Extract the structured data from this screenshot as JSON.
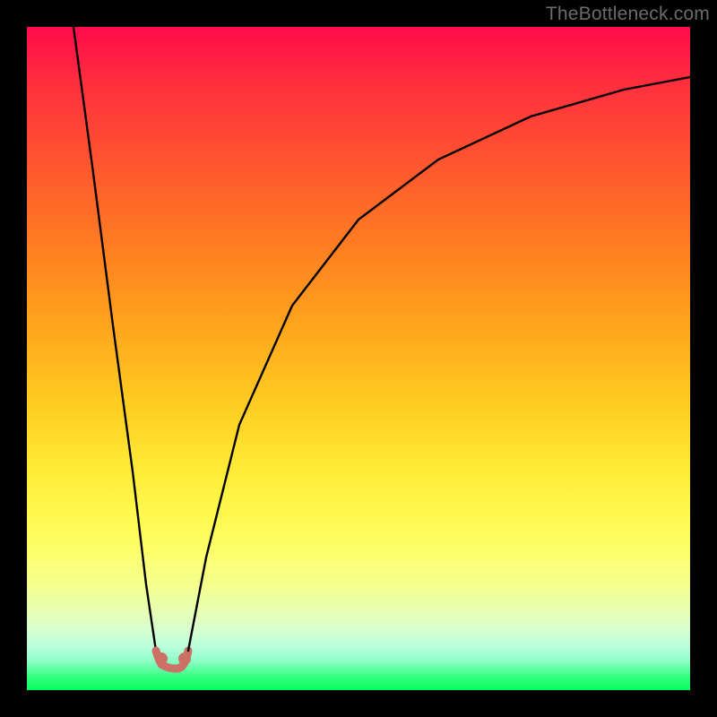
{
  "watermark": {
    "text": "TheBottleneck.com"
  },
  "colors": {
    "frame": "#000000",
    "curve_stroke": "#000000",
    "node_fill": "#cd7066",
    "gradient_stops": [
      "#ff0b4b",
      "#ff2d3f",
      "#ff4a33",
      "#ff6a27",
      "#ff8a1f",
      "#ffab1d",
      "#ffcd22",
      "#ffe935",
      "#fff84c",
      "#fdff6a",
      "#f4ff8c",
      "#e8ffb2",
      "#d6ffd0",
      "#b9ffdc",
      "#8fffc8",
      "#5aff9e",
      "#2bff7a",
      "#05ff5e"
    ]
  },
  "chart_data": {
    "type": "line",
    "x_meaning": "hardware balance parameter (relative, 0–100 across plot width)",
    "y_meaning": "bottleneck severity (relative, 0 = none at bottom, 100 = max at top)",
    "curve_left": {
      "desc": "steep descending branch from top-left into minimum",
      "points": [
        {
          "x": 7,
          "y": 100
        },
        {
          "x": 10,
          "y": 78
        },
        {
          "x": 13,
          "y": 55
        },
        {
          "x": 16,
          "y": 33
        },
        {
          "x": 18,
          "y": 16
        },
        {
          "x": 19.5,
          "y": 6
        }
      ]
    },
    "minimum_basin": {
      "desc": "flat rounded minimum near bottom",
      "points": [
        {
          "x": 20,
          "y": 4
        },
        {
          "x": 21,
          "y": 3.8
        },
        {
          "x": 22.5,
          "y": 3.8
        },
        {
          "x": 23.5,
          "y": 4
        }
      ],
      "nodes": [
        {
          "x": 20,
          "y": 4.5
        },
        {
          "x": 23.5,
          "y": 4.5
        }
      ]
    },
    "curve_right": {
      "desc": "rising concave branch from minimum toward upper-right",
      "points": [
        {
          "x": 24,
          "y": 6
        },
        {
          "x": 27,
          "y": 20
        },
        {
          "x": 32,
          "y": 40
        },
        {
          "x": 40,
          "y": 58
        },
        {
          "x": 50,
          "y": 71
        },
        {
          "x": 62,
          "y": 80
        },
        {
          "x": 76,
          "y": 86.5
        },
        {
          "x": 90,
          "y": 90.5
        },
        {
          "x": 100,
          "y": 92.5
        }
      ]
    },
    "xlim": [
      0,
      100
    ],
    "ylim": [
      0,
      100
    ],
    "title": "",
    "xlabel": "",
    "ylabel": ""
  }
}
